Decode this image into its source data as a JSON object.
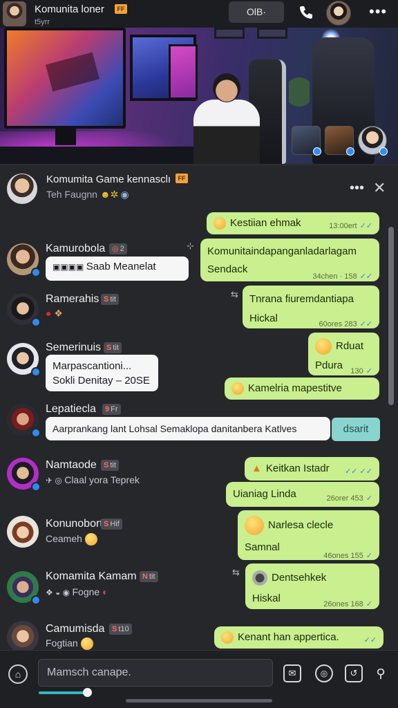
{
  "topbar": {
    "title": "Komunita loner",
    "badge": "FF",
    "subtitle": "t5yrr",
    "pill_label": "OlB·",
    "more": "•••"
  },
  "chat_header": {
    "title": "Komumita Game kennasclı",
    "badge": "FF",
    "subtitle": "Teh Faugnn",
    "more": "•••",
    "close": "✕"
  },
  "messages_in": [
    {
      "name": "Kamurobola",
      "tag": "2",
      "bubble": "Saab Meanelat"
    },
    {
      "name": "Ramerahis",
      "tag": "tit",
      "sub": ""
    },
    {
      "name": "Semerinuis",
      "tag": "tit",
      "bubble_line1": "Marpascantioni...",
      "bubble_line2": "Sokli Denitay – 20SE"
    },
    {
      "name": "Lepatiecla",
      "tag": "Fr",
      "bubble": "Aarprankang lant  Lohsal  Semaklopa danitanbera Katlves"
    },
    {
      "name": "Namtaode",
      "tag": "tit",
      "sub": "Claal yora Teprek"
    },
    {
      "name": "Konunobort:",
      "tag": "Hif",
      "sub": "Ceameh"
    },
    {
      "name": "Komamita Kamam",
      "tag": "tit",
      "sub": "Fogne"
    },
    {
      "name": "Camumisda",
      "tag": "t10",
      "sub": "Fogtian"
    }
  ],
  "messages_out": [
    {
      "line1": "Kestiian ehmak",
      "meta": "13:00ert"
    },
    {
      "line1": "Komunitaindapanganladarlagam",
      "line2": "Sendack",
      "meta": "34chen · 158"
    },
    {
      "line1": "Tnrana fiuremdantiapa",
      "line2": "Hickal",
      "meta": "60ores  283"
    },
    {
      "line1": "Rduat",
      "line2": "Pdura",
      "meta": "130"
    },
    {
      "line1": "Kamelria mapestitve",
      "meta": ""
    },
    {
      "line1": "Keitkan Istadr",
      "meta": ""
    },
    {
      "line1": "Uianiag Linda",
      "meta": "26orer  453"
    },
    {
      "line1": "Narlesa clecle",
      "line2": "Samnal",
      "meta": "46ones  155"
    },
    {
      "line1": "Dentsehkek",
      "line2": "Hiskal",
      "meta": "26ones  168"
    },
    {
      "line1": "Kenant han appertica.",
      "meta": ""
    }
  ],
  "dsarit_label": "dsarit",
  "composer": {
    "placeholder": "Mamsch canape.",
    "left_icon": "⌂"
  },
  "icons": {
    "topbar_phone": "phone-icon",
    "topbar_more": "more-icon",
    "close": "close-icon",
    "composer": [
      "sticker-icon",
      "camera-icon",
      "gif-icon",
      "bulb-icon"
    ]
  },
  "colors": {
    "outgoing_bubble": "#c9ef8e",
    "incoming_bubble": "#f6f6f7",
    "verified": "#2e8bef",
    "accent_badge": "#f2a33a",
    "background": "#26272b"
  }
}
